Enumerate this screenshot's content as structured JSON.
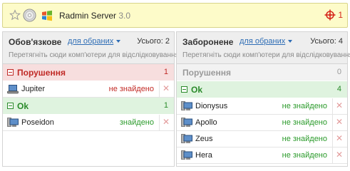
{
  "header": {
    "app_name": "Radmin Server",
    "version": "3.0",
    "alert_count": "1",
    "icons": [
      "star-icon",
      "disc-icon",
      "windows-icon",
      "crosshair-alert-icon"
    ]
  },
  "left": {
    "title": "Обов'язкове",
    "sort_label": "для обраних",
    "total": "Усього: 2",
    "hint": "Перетягніть сюди комп'ютери для відслідковування",
    "groups": [
      {
        "name": "Порушення",
        "count": "1",
        "rows": [
          {
            "name": "Jupiter",
            "status": "не знайдено"
          }
        ]
      },
      {
        "name": "Ok",
        "count": "1",
        "rows": [
          {
            "name": "Poseidon",
            "status": "знайдено"
          }
        ]
      }
    ]
  },
  "right": {
    "title": "Заборонене",
    "sort_label": "для обраних",
    "total": "Усього: 4",
    "hint": "Перетягніть сюди комп'ютери для відслідковування",
    "groups": [
      {
        "name": "Порушення",
        "count": "0",
        "rows": []
      },
      {
        "name": "Ok",
        "count": "4",
        "rows": [
          {
            "name": "Dionysus",
            "status": "не знайдено"
          },
          {
            "name": "Apollo",
            "status": "не знайдено"
          },
          {
            "name": "Zeus",
            "status": "не знайдено"
          },
          {
            "name": "Hera",
            "status": "не знайдено"
          }
        ]
      }
    ]
  },
  "colors": {
    "violation": "#c02a26",
    "ok": "#2a8a2a",
    "accent": "#2e6db5"
  }
}
